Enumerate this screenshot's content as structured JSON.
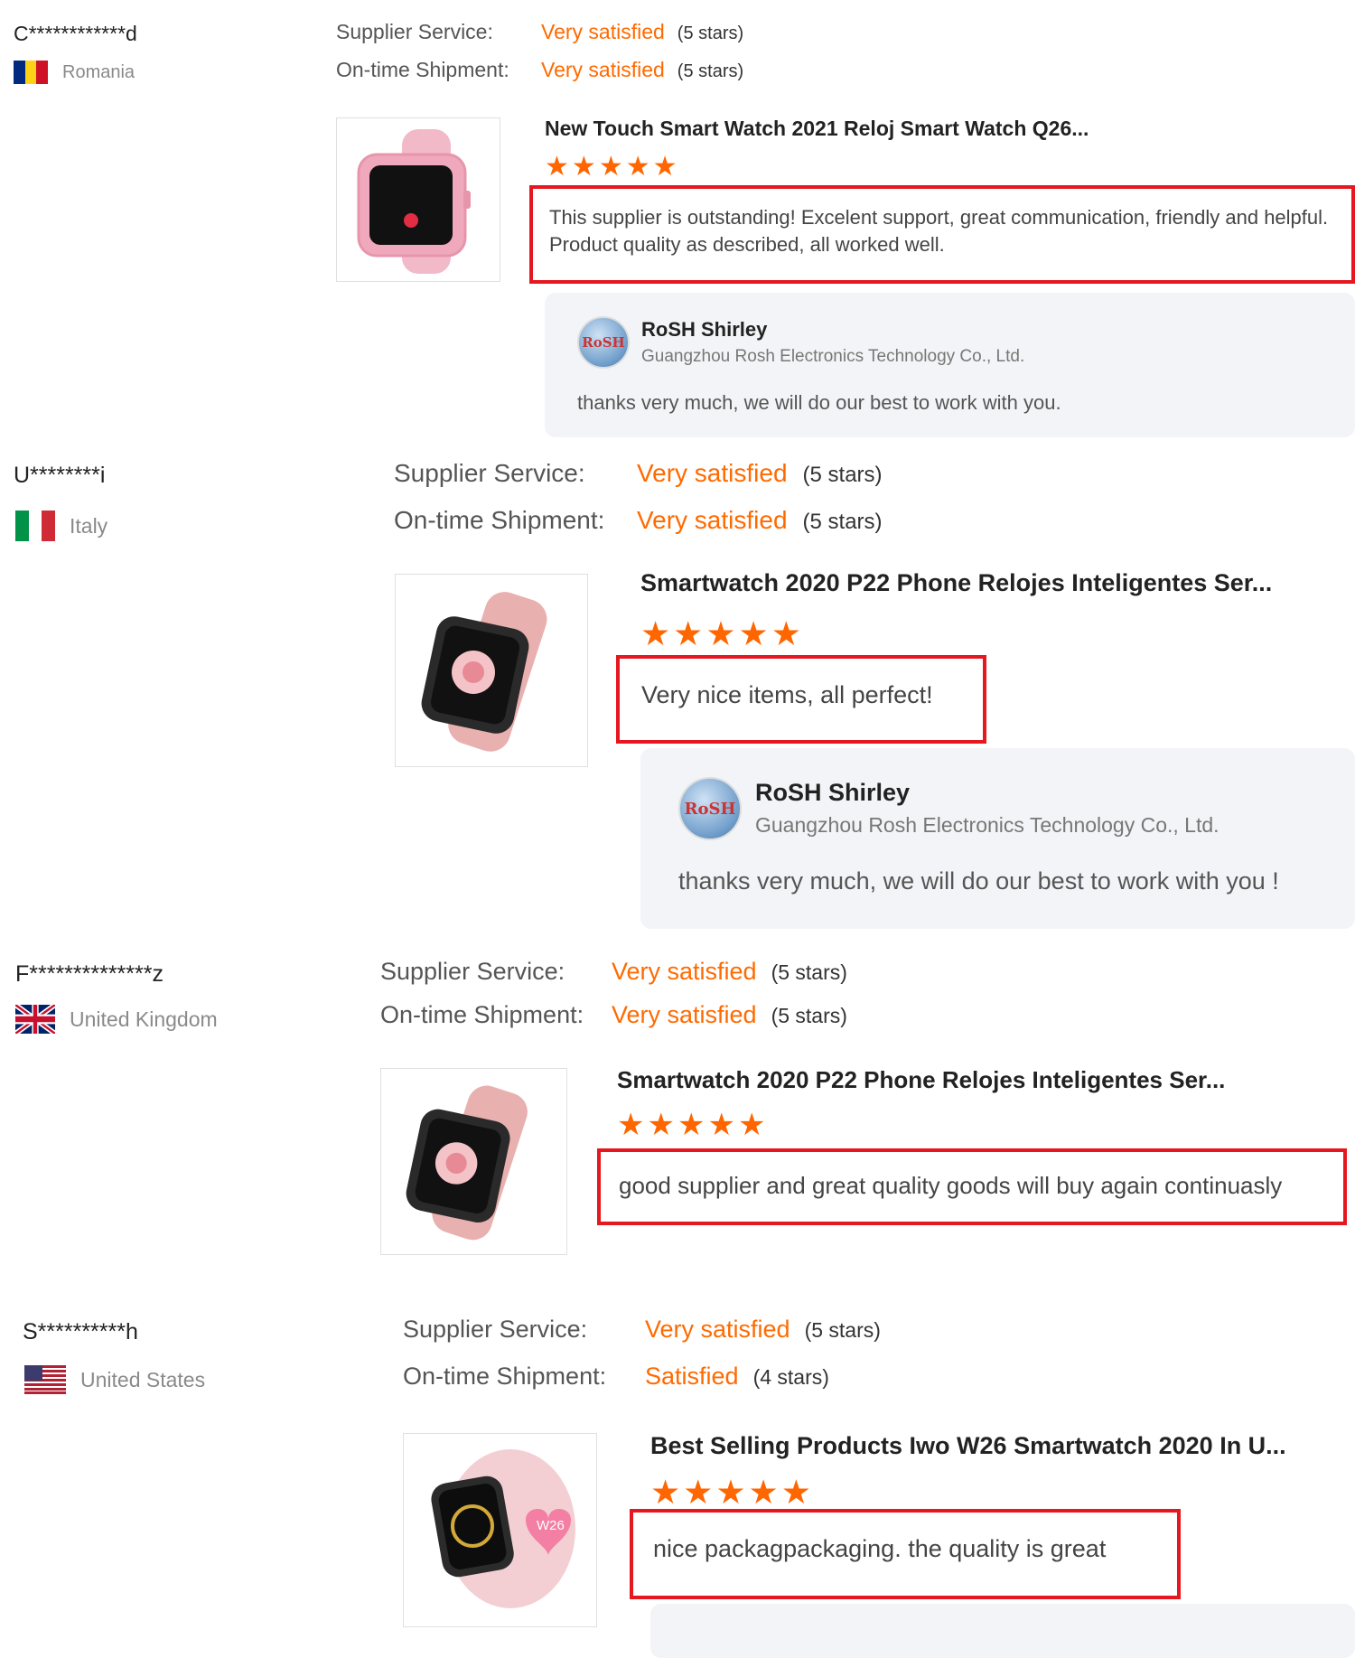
{
  "reviews": [
    {
      "buyer": "C************d",
      "country": "Romania",
      "flag_colors": [
        "#002B7F",
        "#FCD116",
        "#CE1126"
      ],
      "ratings": [
        {
          "label": "Supplier Service:",
          "level": "Very satisfied",
          "stars": "(5 stars)"
        },
        {
          "label": "On-time Shipment:",
          "level": "Very satisfied",
          "stars": "(5 stars)"
        }
      ],
      "product": {
        "title": "New Touch Smart Watch 2021 Reloj Smart Watch Q26...",
        "rating": 5
      },
      "comment": "This supplier is outstanding! Excelent support, great communication, friendly and helpful. Product quality as described, all worked well.",
      "reply": {
        "avatar": "RoSH",
        "name": "RoSH Shirley",
        "company": "Guangzhou Rosh Electronics Technology Co., Ltd.",
        "text": "thanks very much, we will do our best to work with you."
      }
    },
    {
      "buyer": "U********i",
      "country": "Italy",
      "flag_colors": [
        "#009246",
        "#FFFFFF",
        "#CE2B37"
      ],
      "ratings": [
        {
          "label": "Supplier Service:",
          "level": "Very satisfied",
          "stars": "(5 stars)"
        },
        {
          "label": "On-time Shipment:",
          "level": "Very satisfied",
          "stars": "(5 stars)"
        }
      ],
      "product": {
        "title": "Smartwatch 2020 P22 Phone Relojes Inteligentes Ser...",
        "rating": 5
      },
      "comment": "Very nice items, all perfect!",
      "reply": {
        "avatar": "RoSH",
        "name": "RoSH Shirley",
        "company": "Guangzhou Rosh Electronics Technology Co., Ltd.",
        "text": "thanks very much, we will do our best to work with you !"
      }
    },
    {
      "buyer": "F**************z",
      "country": "United Kingdom",
      "ratings": [
        {
          "label": "Supplier Service:",
          "level": "Very satisfied",
          "stars": "(5 stars)"
        },
        {
          "label": "On-time Shipment:",
          "level": "Very satisfied",
          "stars": "(5 stars)"
        }
      ],
      "product": {
        "title": "Smartwatch 2020 P22 Phone Relojes Inteligentes Ser...",
        "rating": 5
      },
      "comment": "good supplier and great quality goods will buy again continuasly"
    },
    {
      "buyer": "S**********h",
      "country": "United States",
      "ratings": [
        {
          "label": "Supplier Service:",
          "level": "Very satisfied",
          "stars": "(5 stars)"
        },
        {
          "label": "On-time Shipment:",
          "level": "Satisfied",
          "stars": "(4 stars)"
        }
      ],
      "product": {
        "title": "Best Selling Products Iwo W26 Smartwatch 2020 In U...",
        "rating": 5,
        "badge": "W26"
      },
      "comment": "nice packagpackaging. the quality is great"
    }
  ],
  "colors": {
    "accent": "#ff6a00",
    "star": "#ff6600",
    "highlight_border": "#e5171f",
    "reply_bg": "#f3f4f7"
  },
  "icons": {
    "star": "star-icon",
    "avatar": "supplier-avatar-icon"
  }
}
